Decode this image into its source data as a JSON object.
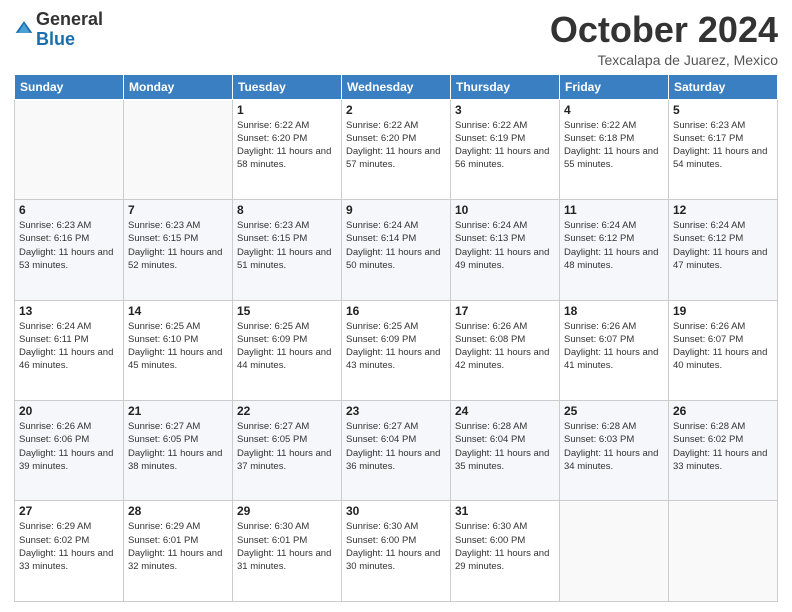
{
  "header": {
    "logo": {
      "line1": "General",
      "line2": "Blue"
    },
    "title": "October 2024",
    "location": "Texcalapa de Juarez, Mexico"
  },
  "weekdays": [
    "Sunday",
    "Monday",
    "Tuesday",
    "Wednesday",
    "Thursday",
    "Friday",
    "Saturday"
  ],
  "weeks": [
    [
      {
        "day": "",
        "info": ""
      },
      {
        "day": "",
        "info": ""
      },
      {
        "day": "1",
        "sunrise": "6:22 AM",
        "sunset": "6:20 PM",
        "daylight": "11 hours and 58 minutes."
      },
      {
        "day": "2",
        "sunrise": "6:22 AM",
        "sunset": "6:20 PM",
        "daylight": "11 hours and 57 minutes."
      },
      {
        "day": "3",
        "sunrise": "6:22 AM",
        "sunset": "6:19 PM",
        "daylight": "11 hours and 56 minutes."
      },
      {
        "day": "4",
        "sunrise": "6:22 AM",
        "sunset": "6:18 PM",
        "daylight": "11 hours and 55 minutes."
      },
      {
        "day": "5",
        "sunrise": "6:23 AM",
        "sunset": "6:17 PM",
        "daylight": "11 hours and 54 minutes."
      }
    ],
    [
      {
        "day": "6",
        "sunrise": "6:23 AM",
        "sunset": "6:16 PM",
        "daylight": "11 hours and 53 minutes."
      },
      {
        "day": "7",
        "sunrise": "6:23 AM",
        "sunset": "6:15 PM",
        "daylight": "11 hours and 52 minutes."
      },
      {
        "day": "8",
        "sunrise": "6:23 AM",
        "sunset": "6:15 PM",
        "daylight": "11 hours and 51 minutes."
      },
      {
        "day": "9",
        "sunrise": "6:24 AM",
        "sunset": "6:14 PM",
        "daylight": "11 hours and 50 minutes."
      },
      {
        "day": "10",
        "sunrise": "6:24 AM",
        "sunset": "6:13 PM",
        "daylight": "11 hours and 49 minutes."
      },
      {
        "day": "11",
        "sunrise": "6:24 AM",
        "sunset": "6:12 PM",
        "daylight": "11 hours and 48 minutes."
      },
      {
        "day": "12",
        "sunrise": "6:24 AM",
        "sunset": "6:12 PM",
        "daylight": "11 hours and 47 minutes."
      }
    ],
    [
      {
        "day": "13",
        "sunrise": "6:24 AM",
        "sunset": "6:11 PM",
        "daylight": "11 hours and 46 minutes."
      },
      {
        "day": "14",
        "sunrise": "6:25 AM",
        "sunset": "6:10 PM",
        "daylight": "11 hours and 45 minutes."
      },
      {
        "day": "15",
        "sunrise": "6:25 AM",
        "sunset": "6:09 PM",
        "daylight": "11 hours and 44 minutes."
      },
      {
        "day": "16",
        "sunrise": "6:25 AM",
        "sunset": "6:09 PM",
        "daylight": "11 hours and 43 minutes."
      },
      {
        "day": "17",
        "sunrise": "6:26 AM",
        "sunset": "6:08 PM",
        "daylight": "11 hours and 42 minutes."
      },
      {
        "day": "18",
        "sunrise": "6:26 AM",
        "sunset": "6:07 PM",
        "daylight": "11 hours and 41 minutes."
      },
      {
        "day": "19",
        "sunrise": "6:26 AM",
        "sunset": "6:07 PM",
        "daylight": "11 hours and 40 minutes."
      }
    ],
    [
      {
        "day": "20",
        "sunrise": "6:26 AM",
        "sunset": "6:06 PM",
        "daylight": "11 hours and 39 minutes."
      },
      {
        "day": "21",
        "sunrise": "6:27 AM",
        "sunset": "6:05 PM",
        "daylight": "11 hours and 38 minutes."
      },
      {
        "day": "22",
        "sunrise": "6:27 AM",
        "sunset": "6:05 PM",
        "daylight": "11 hours and 37 minutes."
      },
      {
        "day": "23",
        "sunrise": "6:27 AM",
        "sunset": "6:04 PM",
        "daylight": "11 hours and 36 minutes."
      },
      {
        "day": "24",
        "sunrise": "6:28 AM",
        "sunset": "6:04 PM",
        "daylight": "11 hours and 35 minutes."
      },
      {
        "day": "25",
        "sunrise": "6:28 AM",
        "sunset": "6:03 PM",
        "daylight": "11 hours and 34 minutes."
      },
      {
        "day": "26",
        "sunrise": "6:28 AM",
        "sunset": "6:02 PM",
        "daylight": "11 hours and 33 minutes."
      }
    ],
    [
      {
        "day": "27",
        "sunrise": "6:29 AM",
        "sunset": "6:02 PM",
        "daylight": "11 hours and 33 minutes."
      },
      {
        "day": "28",
        "sunrise": "6:29 AM",
        "sunset": "6:01 PM",
        "daylight": "11 hours and 32 minutes."
      },
      {
        "day": "29",
        "sunrise": "6:30 AM",
        "sunset": "6:01 PM",
        "daylight": "11 hours and 31 minutes."
      },
      {
        "day": "30",
        "sunrise": "6:30 AM",
        "sunset": "6:00 PM",
        "daylight": "11 hours and 30 minutes."
      },
      {
        "day": "31",
        "sunrise": "6:30 AM",
        "sunset": "6:00 PM",
        "daylight": "11 hours and 29 minutes."
      },
      {
        "day": "",
        "info": ""
      },
      {
        "day": "",
        "info": ""
      }
    ]
  ]
}
